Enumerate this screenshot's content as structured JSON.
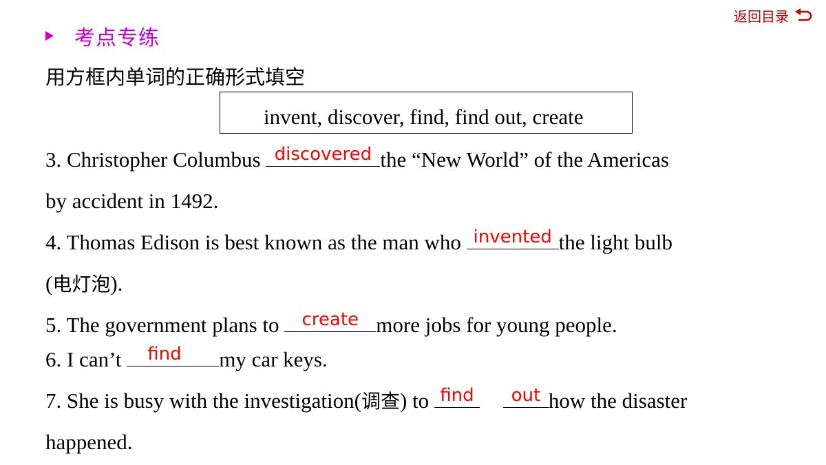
{
  "nav": {
    "back_label": "返回目录",
    "back_icon": "return-arrow-icon"
  },
  "section": {
    "title": "考点专练",
    "bullet_icon": "triangle-bullet-icon",
    "color": "#cc00cc"
  },
  "instruction": "用方框内单词的正确形式填空",
  "word_box": "invent, discover, find, find out, create",
  "answer_color": "#ff0000",
  "exercises": {
    "q3": {
      "before": "3. Christopher Columbus ",
      "answer": "discovered",
      "after": "the “New World” of the Americas",
      "line2": "by accident in 1492."
    },
    "q4": {
      "before": "4. Thomas Edison is best known as the man who ",
      "answer": "invented",
      "after": "the light bulb",
      "line2_open": "(",
      "line2_cn": "电灯泡",
      "line2_close": ")."
    },
    "q5": {
      "before": "5. The government plans to ",
      "answer": "create",
      "after": "more jobs for young people."
    },
    "q6": {
      "before": "6. I can’t ",
      "answer": "find",
      "after": "my car keys."
    },
    "q7": {
      "before": "7. She is busy with the investigation(",
      "cn": "调查",
      "mid": ") to ",
      "answer1": "find",
      "answer2": "out",
      "after": "how the disaster",
      "line2": "happened."
    }
  }
}
